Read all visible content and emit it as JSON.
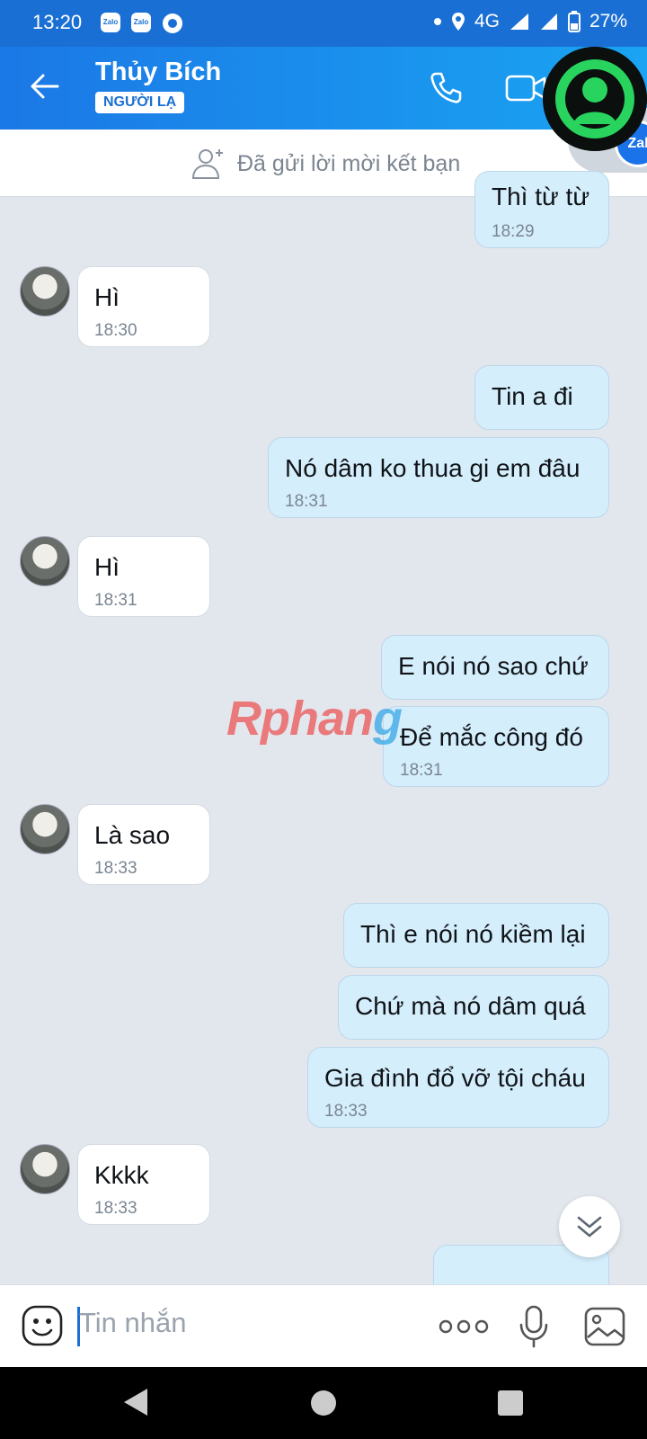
{
  "status_bar": {
    "time": "13:20",
    "app_icon_1": "Zalo",
    "app_icon_2": "Zalo",
    "network": "4G",
    "battery": "27%"
  },
  "header": {
    "contact_name": "Thủy Bích",
    "tag": "NGƯỜI LẠ",
    "group_badge": "Zal"
  },
  "friend_request": {
    "text": "Đã gửi lời mời kết bạn"
  },
  "messages": [
    {
      "from": "me",
      "text": "Thì từ từ",
      "time": "18:29"
    },
    {
      "from": "them",
      "text": "Hì",
      "time": "18:30"
    },
    {
      "from": "me",
      "text": "Tin a đi",
      "time": ""
    },
    {
      "from": "me",
      "text": "Nó dâm ko thua gi em đâu",
      "time": "18:31"
    },
    {
      "from": "them",
      "text": "Hì",
      "time": "18:31"
    },
    {
      "from": "me",
      "text": "E nói nó sao chứ",
      "time": ""
    },
    {
      "from": "me",
      "text": "Để mắc công đó",
      "time": "18:31"
    },
    {
      "from": "them",
      "text": "Là sao",
      "time": "18:33"
    },
    {
      "from": "me",
      "text": "Thì e nói nó kiềm lại",
      "time": ""
    },
    {
      "from": "me",
      "text": "Chứ mà nó dâm quá",
      "time": ""
    },
    {
      "from": "me",
      "text": "Gia đình đổ vỡ tội cháu",
      "time": "18:33"
    },
    {
      "from": "them",
      "text": "Kkkk",
      "time": "18:33"
    }
  ],
  "watermark": {
    "part1": "Rphan",
    "part2": "g"
  },
  "input": {
    "placeholder": "Tin nhắn"
  },
  "colors": {
    "header_start": "#1b78e6",
    "header_end": "#1aa4f2",
    "my_bubble": "#d5eefc",
    "chat_bg": "#e2e7ee"
  },
  "icons": [
    "back-arrow-icon",
    "phone-icon",
    "video-icon",
    "add-friend-icon",
    "scroll-down-icon",
    "emoji-icon",
    "more-icon",
    "mic-icon",
    "gallery-icon",
    "nav-back-icon",
    "nav-home-icon",
    "nav-recents-icon"
  ]
}
